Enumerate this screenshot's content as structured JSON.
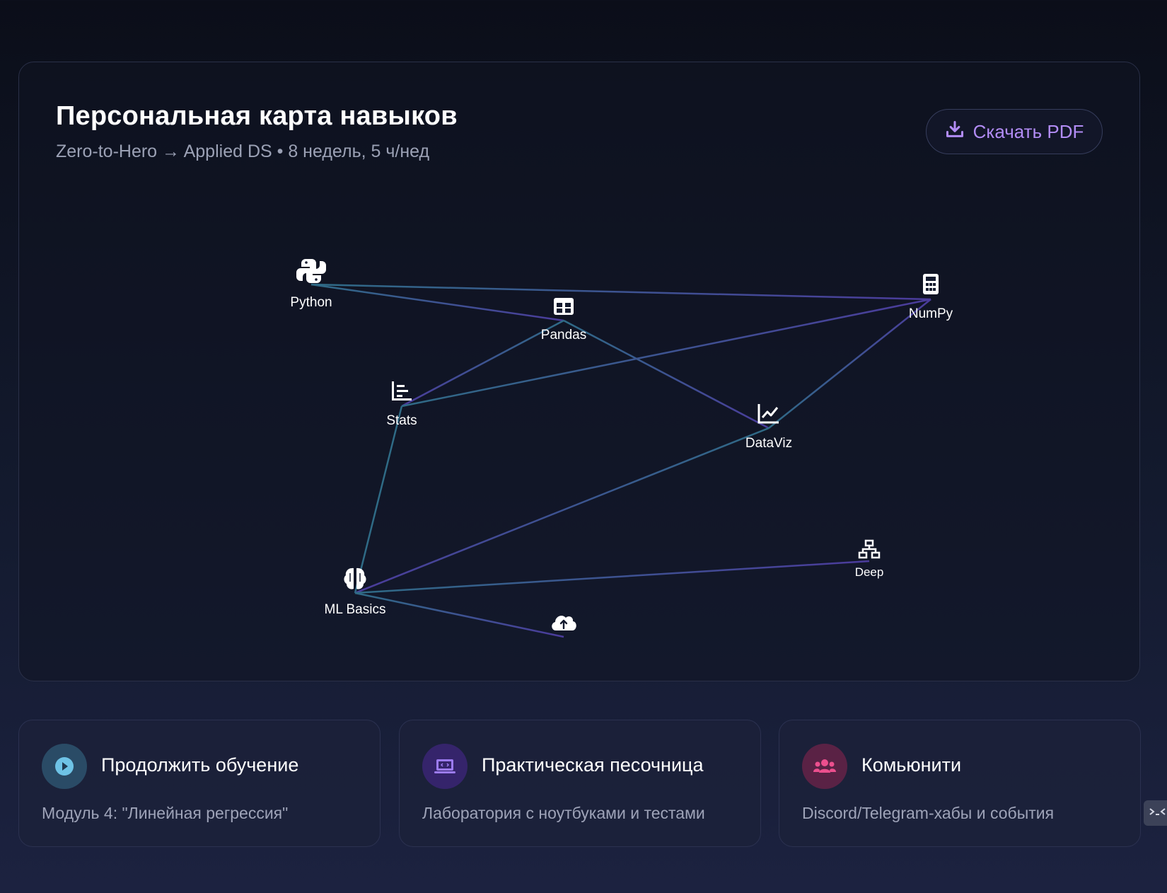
{
  "skill_map": {
    "title": "Персональная карта навыков",
    "subtitle": "Zero-to-Hero → Applied DS • 8 недель, 5 ч/нед",
    "download_label": "Скачать PDF",
    "download_icon": "download-icon",
    "nodes": {
      "python": {
        "label": "Python",
        "icon": "python-icon"
      },
      "pandas": {
        "label": "Pandas",
        "icon": "table-icon"
      },
      "numpy": {
        "label": "NumPy",
        "icon": "calculator-icon"
      },
      "stats": {
        "label": "Stats",
        "icon": "bar-chart-icon"
      },
      "dataviz": {
        "label": "DataViz",
        "icon": "line-chart-icon"
      },
      "ml_basics": {
        "label": "ML Basics",
        "icon": "brain-icon"
      },
      "deep": {
        "label": "Deep",
        "icon": "network-icon"
      },
      "deploy": {
        "label": "",
        "icon": "cloud-upload-icon"
      }
    },
    "colors": {
      "edge_teal": "#2f6b86",
      "edge_purple": "#4b3b9c"
    }
  },
  "cards": [
    {
      "title": "Продолжить обучение",
      "description": "Модуль 4: \"Линейная регрессия\"",
      "icon": "play-icon",
      "color": "#6ec3e6"
    },
    {
      "title": "Практическая песочница",
      "description": "Лаборатория с ноутбуками и тестами",
      "icon": "laptop-code-icon",
      "color": "#9c7bf0"
    },
    {
      "title": "Комьюнити",
      "description": "Discord/Telegram-хабы и события",
      "icon": "users-icon",
      "color": "#ec4f8e"
    }
  ],
  "side_tab": {
    "icon": "feedback-icon"
  }
}
